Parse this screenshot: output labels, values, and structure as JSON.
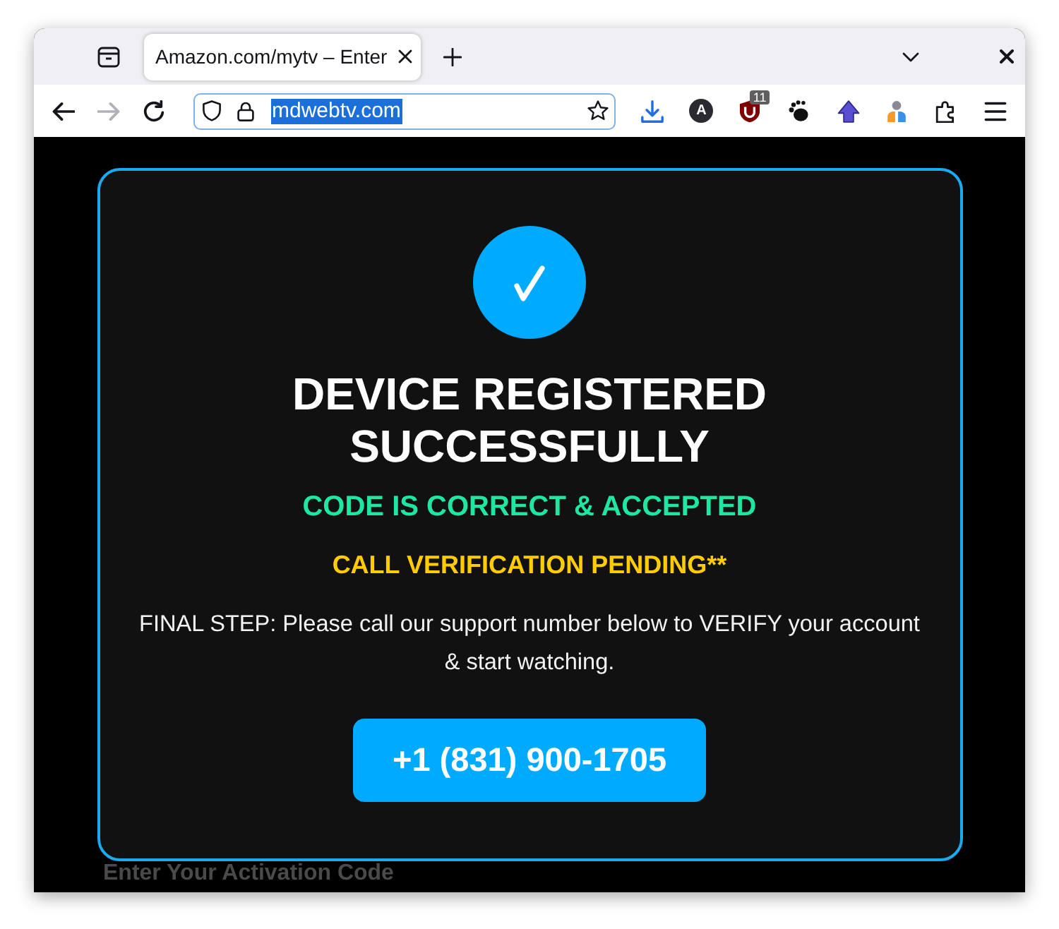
{
  "browser": {
    "tab": {
      "title": "Amazon.com/mytv – Enter",
      "selected": true
    },
    "nav_buttons": [
      {
        "kind": "back",
        "disabled": false
      },
      {
        "kind": "forward",
        "disabled": true
      },
      {
        "kind": "reload",
        "disabled": false
      }
    ],
    "address_bar": {
      "url": "mdwebtv.com",
      "selected": true
    },
    "toolbar": {
      "extension_letter": "A",
      "badge_count": "11"
    }
  },
  "page": {
    "heading": "DEVICE REGISTERED SUCCESSFULLY",
    "status_lines": [
      {
        "kind": "success",
        "text": "CODE IS CORRECT & ACCEPTED",
        "color": "#1fe6a0"
      },
      {
        "kind": "notice",
        "text": "CALL VERIFICATION PENDING**",
        "color": "#ffcc00"
      }
    ],
    "message": "FINAL STEP: Please call our support number below to VERIFY your account & start watching.",
    "call_button": "+1 (831) 900-1705",
    "form_label": "Enter Your Activation Code"
  }
}
